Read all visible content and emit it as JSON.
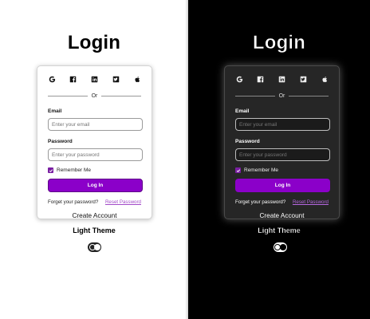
{
  "title": "Login",
  "socials": [
    "google-icon",
    "facebook-icon",
    "linkedin-icon",
    "twitter-icon",
    "apple-icon"
  ],
  "divider_text": "Or",
  "email": {
    "label": "Email",
    "placeholder": "Enter your email"
  },
  "password": {
    "label": "Password",
    "placeholder": "Enter your password"
  },
  "remember_label": "Remember Me",
  "remember_checked": true,
  "login_button": "Log In",
  "forgot_text": "Forget your password?",
  "reset_link": "Reset Password",
  "create_account": "Create Account",
  "theme_label": "Light Theme",
  "colors": {
    "accent": "#8b00c9",
    "link": "#a24ac8",
    "checkbox": "#7a1fa2"
  }
}
